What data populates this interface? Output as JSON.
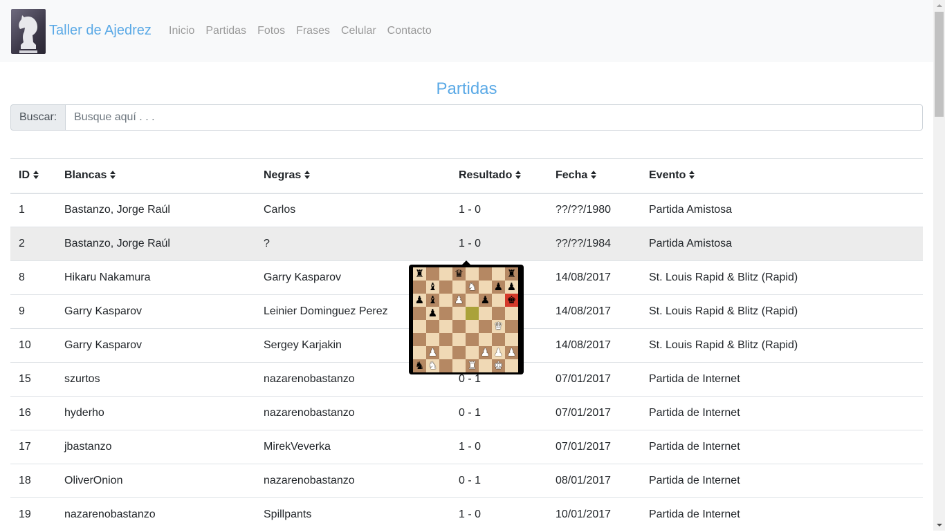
{
  "navbar": {
    "brand": "Taller de Ajedrez",
    "links": [
      "Inicio",
      "Partidas",
      "Fotos",
      "Frases",
      "Celular",
      "Contacto"
    ]
  },
  "page_title": "Partidas",
  "search": {
    "label": "Buscar:",
    "placeholder": "Busque aquí . . ."
  },
  "table": {
    "headers": [
      "ID",
      "Blancas",
      "Negras",
      "Resultado",
      "Fecha",
      "Evento"
    ],
    "rows": [
      [
        "1",
        "Bastanzo, Jorge Raúl",
        "Carlos",
        "1 - 0",
        "??/??/1980",
        "Partida Amistosa"
      ],
      [
        "2",
        "Bastanzo, Jorge Raúl",
        "?",
        "1 - 0",
        "??/??/1984",
        "Partida Amistosa"
      ],
      [
        "8",
        "Hikaru Nakamura",
        "Garry Kasparov",
        "",
        "14/08/2017",
        "St. Louis Rapid & Blitz (Rapid)"
      ],
      [
        "9",
        "Garry Kasparov",
        "Leinier Dominguez Perez",
        "",
        "14/08/2017",
        "St. Louis Rapid & Blitz (Rapid)"
      ],
      [
        "10",
        "Garry Kasparov",
        "Sergey Karjakin",
        "",
        "14/08/2017",
        "St. Louis Rapid & Blitz (Rapid)"
      ],
      [
        "15",
        "szurtos",
        "nazarenobastanzo",
        "0 - 1",
        "07/01/2017",
        "Partida de Internet"
      ],
      [
        "16",
        "hyderho",
        "nazarenobastanzo",
        "0 - 1",
        "07/01/2017",
        "Partida de Internet"
      ],
      [
        "17",
        "jbastanzo",
        "MirekVeverka",
        "1 - 0",
        "07/01/2017",
        "Partida de Internet"
      ],
      [
        "18",
        "OliverOnion",
        "nazarenobastanzo",
        "0 - 1",
        "08/01/2017",
        "Partida de Internet"
      ],
      [
        "19",
        "nazarenobastanzo",
        "Spillpants",
        "1 - 0",
        "10/01/2017",
        "Partida de Internet"
      ]
    ],
    "highlighted_row": 1
  },
  "preview_board": {
    "ranks": [
      "r..q...r",
      ".b..N.pp",
      "pb.P.p.k",
      ".p......",
      "......Q.",
      "........",
      ".P...PPP",
      "nN..R.K."
    ],
    "highlight_last_move": [
      [
        3,
        4
      ]
    ],
    "highlight_check": [
      [
        2,
        7
      ]
    ]
  }
}
